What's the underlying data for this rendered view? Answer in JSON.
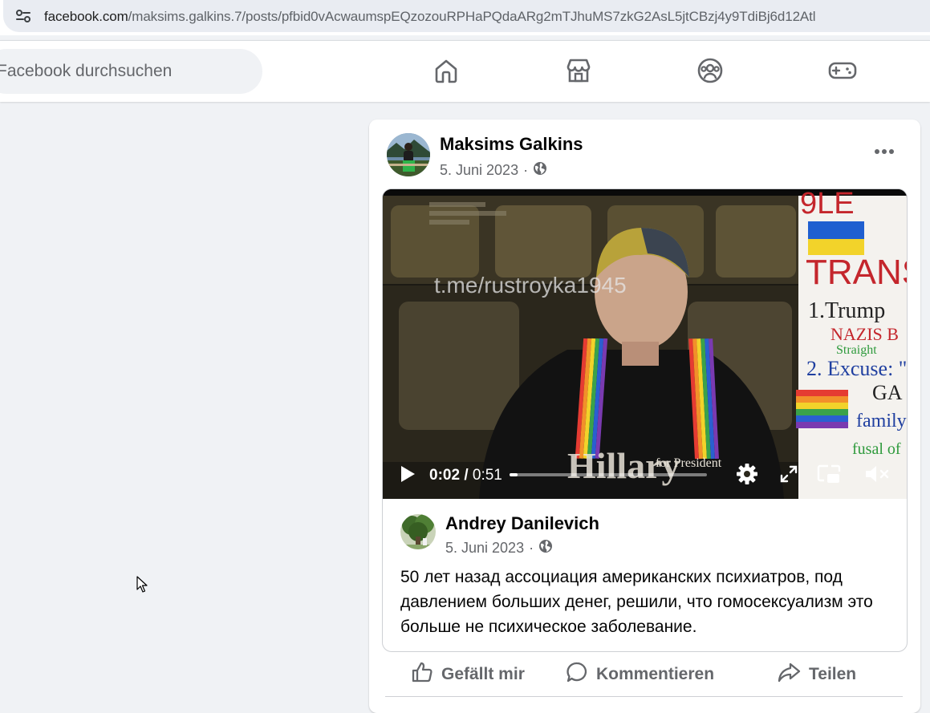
{
  "browser": {
    "url_host": "facebook.com",
    "url_path": "/maksims.galkins.7/posts/pfbid0vAcwaumspEQzozouRPHaPQdaARg2mTJhuMS7zkG2AsL5jtCBzj4y9TdiBj6d12Atl"
  },
  "nav": {
    "search_placeholder": "Facebook durchsuchen",
    "items": [
      {
        "name": "home",
        "icon": "home-icon"
      },
      {
        "name": "marketplace",
        "icon": "store-icon"
      },
      {
        "name": "groups",
        "icon": "groups-icon"
      },
      {
        "name": "gaming",
        "icon": "gamepad-icon"
      }
    ]
  },
  "post": {
    "author": "Maksims Galkins",
    "date": "5. Juni 2023",
    "separator": "·",
    "audience_icon": "globe-icon",
    "more_icon": "more-horizontal-icon"
  },
  "video": {
    "current_time": "0:02",
    "time_separator": "/",
    "duration": "0:51",
    "progress": 0.04,
    "watermark": "t.me/rustroyka1945",
    "controls": [
      "play-icon",
      "settings-icon",
      "fullscreen-icon",
      "picture-in-picture-icon",
      "muted-icon"
    ]
  },
  "shared": {
    "author": "Andrey Danilevich",
    "date": "5. Juni 2023",
    "separator": "·",
    "text": "50 лет назад ассоциация американских психиатров, под давлением больших денег, решили, что гомосексуализм это больше не психическое заболевание."
  },
  "actions": {
    "like": "Gefällt mir",
    "comment": "Kommentieren",
    "share": "Teilen"
  },
  "colors": {
    "page_bg": "#f0f2f5",
    "card_bg": "#ffffff",
    "secondary_text": "#65676b",
    "icon_gray": "#65676b"
  }
}
